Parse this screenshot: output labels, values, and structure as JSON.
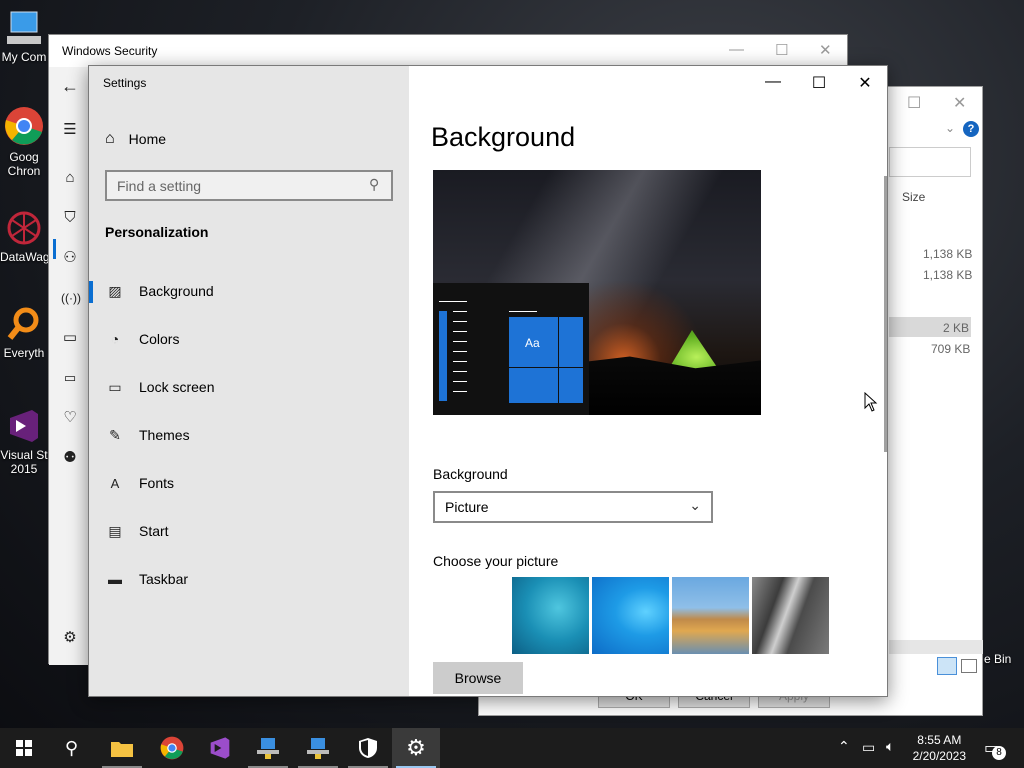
{
  "desktop": {
    "icons": [
      {
        "label": "My Com"
      },
      {
        "label": "Goog Chron"
      },
      {
        "label": "DataWag"
      },
      {
        "label": "Everyth"
      },
      {
        "label": "Visual St 2015"
      }
    ],
    "recycle_label": "e Bin"
  },
  "explorer": {
    "header_size": "Size",
    "sizes": [
      "1,138 KB",
      "1,138 KB",
      "2 KB",
      "709 KB"
    ],
    "buttons": {
      "ok": "OK",
      "cancel": "Cancel",
      "apply": "Apply"
    }
  },
  "winsec": {
    "title": "Windows Security"
  },
  "settings": {
    "window_title": "Settings",
    "home_label": "Home",
    "search_placeholder": "Find a setting",
    "section_title": "Personalization",
    "nav_items": [
      {
        "label": "Background",
        "icon": "image-icon"
      },
      {
        "label": "Colors",
        "icon": "palette-icon"
      },
      {
        "label": "Lock screen",
        "icon": "lock-screen-icon"
      },
      {
        "label": "Themes",
        "icon": "themes-icon"
      },
      {
        "label": "Fonts",
        "icon": "fonts-icon"
      },
      {
        "label": "Start",
        "icon": "start-icon"
      },
      {
        "label": "Taskbar",
        "icon": "taskbar-icon"
      }
    ],
    "active_nav": "Background",
    "page_title": "Background",
    "preview_tile_text": "Aa",
    "background_label": "Background",
    "background_value": "Picture",
    "choose_picture_label": "Choose your picture",
    "browse_label": "Browse"
  },
  "taskbar": {
    "clock_time": "8:55 AM",
    "clock_date": "2/20/2023",
    "notification_count": "8"
  },
  "colors": {
    "accent": "#0a6ed1",
    "nav_bg": "#e6e6e6",
    "taskbar_bg": "#1c1c1c"
  }
}
